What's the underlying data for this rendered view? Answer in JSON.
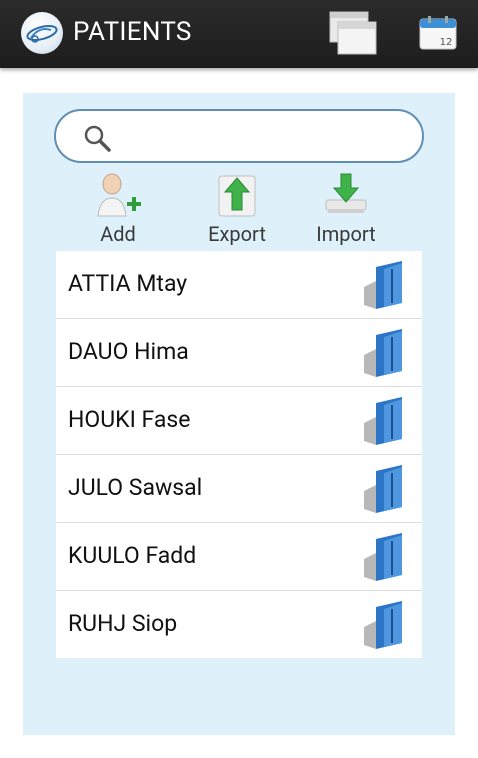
{
  "app": {
    "title": "PATIENTS"
  },
  "search": {
    "placeholder": "",
    "value": ""
  },
  "toolbar": {
    "add_label": "Add",
    "export_label": "Export",
    "import_label": "Import"
  },
  "patients": [
    {
      "name": "ATTIA Mtay"
    },
    {
      "name": "DAUO Hima"
    },
    {
      "name": "HOUKI Fase"
    },
    {
      "name": "JULO Sawsal"
    },
    {
      "name": "KUULO Fadd"
    },
    {
      "name": "RUHJ Siop"
    }
  ],
  "calendar_icon_number": "12",
  "colors": {
    "actionbar": "#222222",
    "panel": "#def1fb",
    "search_border": "#5f8eb4",
    "folder_blue": "#2b74c6"
  }
}
